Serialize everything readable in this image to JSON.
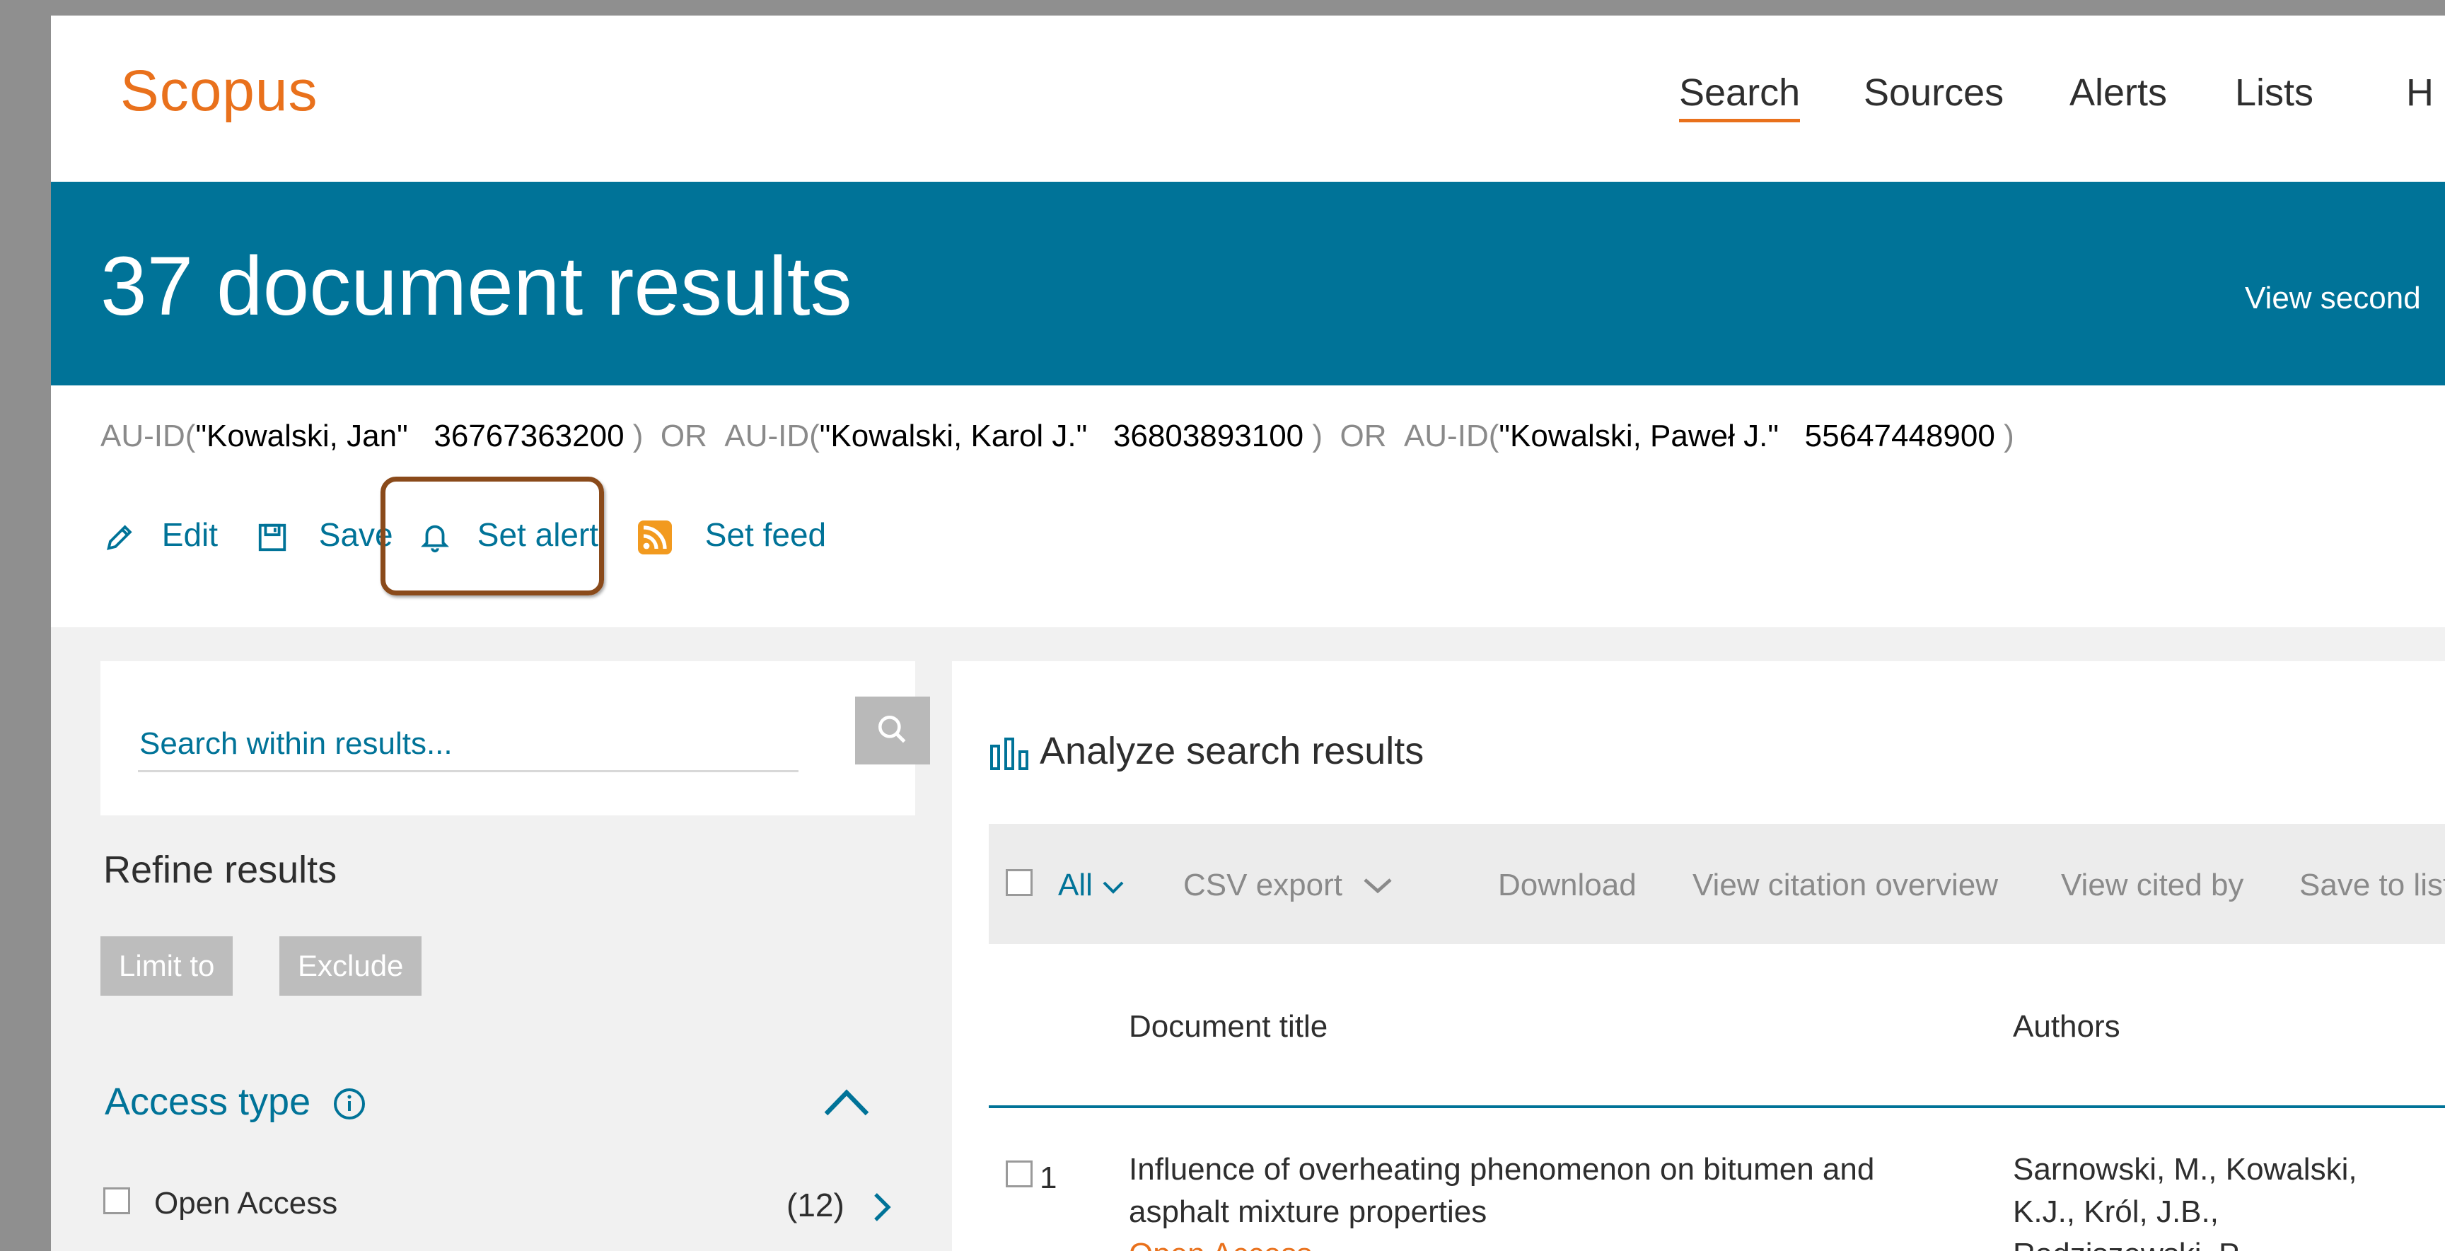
{
  "header": {
    "logo": "Scopus",
    "nav": [
      "Search",
      "Sources",
      "Alerts",
      "Lists",
      "H"
    ]
  },
  "banner": {
    "title": "37 document results",
    "secondary_link": "View second"
  },
  "query": {
    "parts": [
      {
        "op": "AU-ID",
        "open": "(",
        "name": "\"Kowalski, Jan\"",
        "id": "36767363200",
        "close": ")"
      },
      {
        "op": "AU-ID",
        "open": "(",
        "name": "\"Kowalski, Karol J.\"",
        "id": "36803893100",
        "close": ")"
      },
      {
        "op": "AU-ID",
        "open": "(",
        "name": "\"Kowalski, Paweł J.\"",
        "id": "55647448900",
        "close": ")"
      }
    ],
    "joiner": "OR"
  },
  "actions": {
    "edit": "Edit",
    "save": "Save",
    "set_alert": "Set alert",
    "set_feed": "Set feed"
  },
  "sidebar": {
    "search_placeholder": "Search within results...",
    "refine_title": "Refine results",
    "limit_to": "Limit to",
    "exclude": "Exclude",
    "access_type": "Access type",
    "open_access_label": "Open Access",
    "open_access_count": "(12)"
  },
  "results": {
    "analyze": "Analyze search results",
    "toolbar": {
      "all": "All",
      "csv_export": "CSV export",
      "download": "Download",
      "view_citation_overview": "View citation overview",
      "view_cited_by": "View cited by",
      "save_to_list": "Save to list"
    },
    "columns": {
      "title": "Document title",
      "authors": "Authors"
    },
    "rows": [
      {
        "num": "1",
        "title_line1": "Influence of overheating phenomenon on bitumen and",
        "title_line2": "asphalt mixture properties",
        "tag": "Open Access",
        "authors_line1": "Sarnowski, M., Kowalski,",
        "authors_line2": "K.J., Król, J.B.,",
        "authors_line3": "Radziszewski, P."
      }
    ]
  },
  "colors": {
    "brand_orange": "#e9711c",
    "banner_blue": "#007398",
    "highlight_brown": "#8a4a1a"
  }
}
